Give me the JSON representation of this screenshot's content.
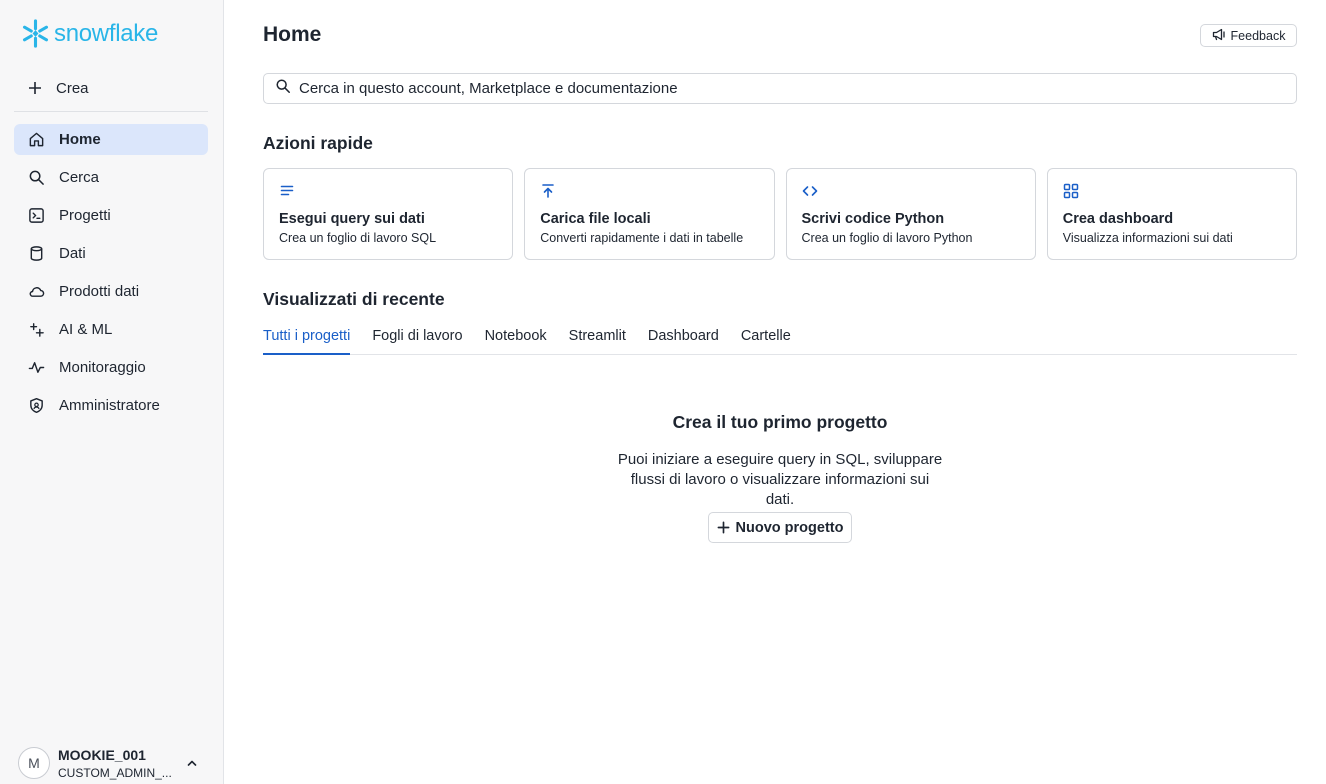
{
  "sidebar": {
    "logo_text": "snowflake",
    "create_label": "Crea",
    "items": [
      {
        "label": "Home",
        "icon": "home-icon",
        "active": true
      },
      {
        "label": "Cerca",
        "icon": "search-icon"
      },
      {
        "label": "Progetti",
        "icon": "projects-icon"
      },
      {
        "label": "Dati",
        "icon": "database-icon"
      },
      {
        "label": "Prodotti dati",
        "icon": "cloud-icon"
      },
      {
        "label": "AI & ML",
        "icon": "sparkle-icon"
      },
      {
        "label": "Monitoraggio",
        "icon": "activity-icon"
      },
      {
        "label": "Amministratore",
        "icon": "shield-icon"
      }
    ],
    "user": {
      "initial": "M",
      "name": "MOOKIE_001",
      "role": "CUSTOM_ADMIN_..."
    }
  },
  "header": {
    "title": "Home",
    "feedback_label": "Feedback"
  },
  "search": {
    "placeholder": "Cerca in questo account, Marketplace e documentazione"
  },
  "quick_actions": {
    "title": "Azioni rapide",
    "cards": [
      {
        "title": "Esegui query sui dati",
        "desc": "Crea un foglio di lavoro SQL",
        "icon": "lines-icon"
      },
      {
        "title": "Carica file locali",
        "desc": "Converti rapidamente i dati in tabelle",
        "icon": "upload-icon"
      },
      {
        "title": "Scrivi codice Python",
        "desc": "Crea un foglio di lavoro Python",
        "icon": "code-icon"
      },
      {
        "title": "Crea dashboard",
        "desc": "Visualizza informazioni sui dati",
        "icon": "grid-icon"
      }
    ]
  },
  "recent": {
    "title": "Visualizzati di recente",
    "tabs": [
      "Tutti i progetti",
      "Fogli di lavoro",
      "Notebook",
      "Streamlit",
      "Dashboard",
      "Cartelle"
    ],
    "active_tab": 0,
    "empty_title": "Crea il tuo primo progetto",
    "empty_desc": "Puoi iniziare a eseguire query in SQL, sviluppare flussi di lavoro o visualizzare informazioni sui dati.",
    "new_project_label": "Nuovo progetto"
  },
  "colors": {
    "brand": "#29b5e8",
    "accent": "#1a5fc8",
    "active_bg": "#dbe6fb"
  }
}
